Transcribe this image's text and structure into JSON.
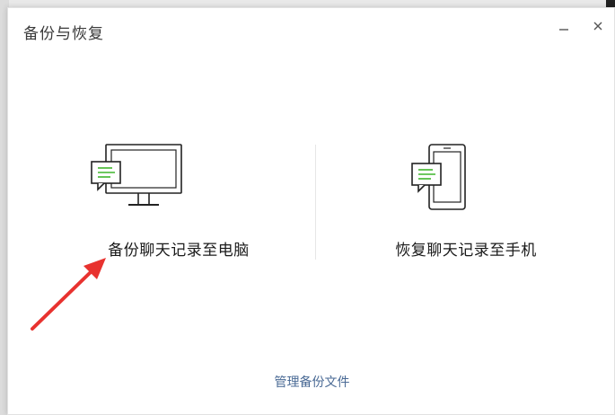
{
  "dialog": {
    "title": "备份与恢复",
    "minimize_icon": "minimize-icon",
    "close_icon": "close-icon"
  },
  "options": [
    {
      "label": "备份聊天记录至电脑",
      "icon": "computer-with-message-icon"
    },
    {
      "label": "恢复聊天记录至手机",
      "icon": "phone-with-message-icon"
    }
  ],
  "footer": {
    "manage_label": "管理备份文件"
  },
  "colors": {
    "accent_green": "#3fb52c",
    "link_blue": "#4a6a95",
    "annotation_red": "#e8322f"
  }
}
